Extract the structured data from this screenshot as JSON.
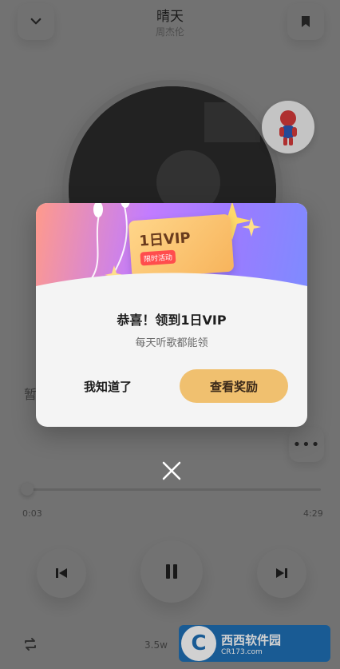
{
  "player": {
    "song_title": "晴天",
    "artist": "周杰伦",
    "lyric_hint": "暂",
    "time_current": "0:03",
    "time_total": "4:29",
    "play_count": "3.5w",
    "progress": 0.011
  },
  "icons": {
    "back": "chevron-down-icon",
    "bookmark": "bookmark-icon",
    "prev": "skip-previous-icon",
    "pause": "pause-icon",
    "next": "skip-next-icon",
    "loop": "repeat-icon",
    "more": "more-icon",
    "close": "close-icon"
  },
  "modal": {
    "badge_text": "1日VIP",
    "badge_tag": "限时活动",
    "title": "恭喜！领到1日VIP",
    "subtitle": "每天听歌都能领",
    "dismiss_label": "我知道了",
    "view_reward_label": "查看奖励"
  },
  "watermark": {
    "logo_char": "C",
    "text": "西西软件园",
    "site": "CR173.com"
  },
  "colors": {
    "primary_button": "#f0c06f",
    "banner_start": "#ff9a8b",
    "banner_end": "#7e8bff"
  }
}
